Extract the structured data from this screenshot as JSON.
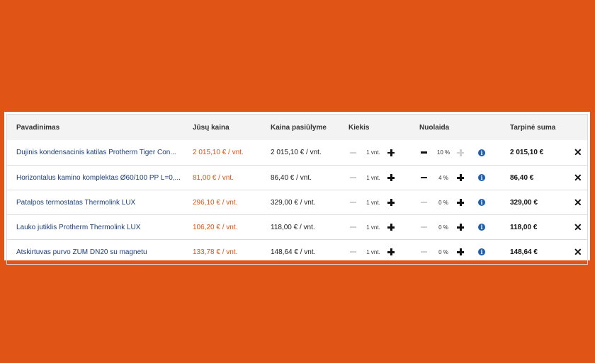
{
  "columns": {
    "name": "Pavadinimas",
    "your_price": "Jūsų kaina",
    "offer_price": "Kaina pasiūlyme",
    "qty": "Kiekis",
    "discount": "Nuolaida",
    "subtotal": "Tarpinė suma"
  },
  "rows": [
    {
      "name": "Dujinis kondensacinis katilas Protherm Tiger Con...",
      "your_price": "2 015,10 € / vnt.",
      "offer_price": "2 015,10 € / vnt.",
      "qty": "1 vnt.",
      "discount": "10 %",
      "subtotal": "2 015,10 €",
      "discount_minus_active": true,
      "discount_plus_active": false
    },
    {
      "name": "Horizontalus kamino komplektas Ø60/100 PP L=0,...",
      "your_price": "81,00 € / vnt.",
      "offer_price": "86,40 € / vnt.",
      "qty": "1 vnt.",
      "discount": "4 %",
      "subtotal": "86,40 €",
      "discount_minus_active": true,
      "discount_plus_active": true
    },
    {
      "name": "Patalpos termostatas Thermolink LUX",
      "your_price": "296,10 € / vnt.",
      "offer_price": "329,00 € / vnt.",
      "qty": "1 vnt.",
      "discount": "0 %",
      "subtotal": "329,00 €",
      "discount_minus_active": false,
      "discount_plus_active": true
    },
    {
      "name": "Lauko jutiklis Protherm Thermolink LUX",
      "your_price": "106,20 € / vnt.",
      "offer_price": "118,00 € / vnt.",
      "qty": "1 vnt.",
      "discount": "0 %",
      "subtotal": "118,00 €",
      "discount_minus_active": false,
      "discount_plus_active": true
    },
    {
      "name": "Atskirtuvas purvo ZUM DN20 su magnetu",
      "your_price": "133,78 € / vnt.",
      "offer_price": "148,64 € / vnt.",
      "qty": "1 vnt.",
      "discount": "0 %",
      "subtotal": "148,64 €",
      "discount_minus_active": false,
      "discount_plus_active": true
    }
  ],
  "icons": {
    "remove": "close-icon",
    "info": "info-icon",
    "increment": "plus-icon",
    "decrement": "minus-icon"
  },
  "colors": {
    "background": "#e05416",
    "your_price": "#e05416",
    "link": "#1c3f7a",
    "info": "#1b5fb5"
  }
}
